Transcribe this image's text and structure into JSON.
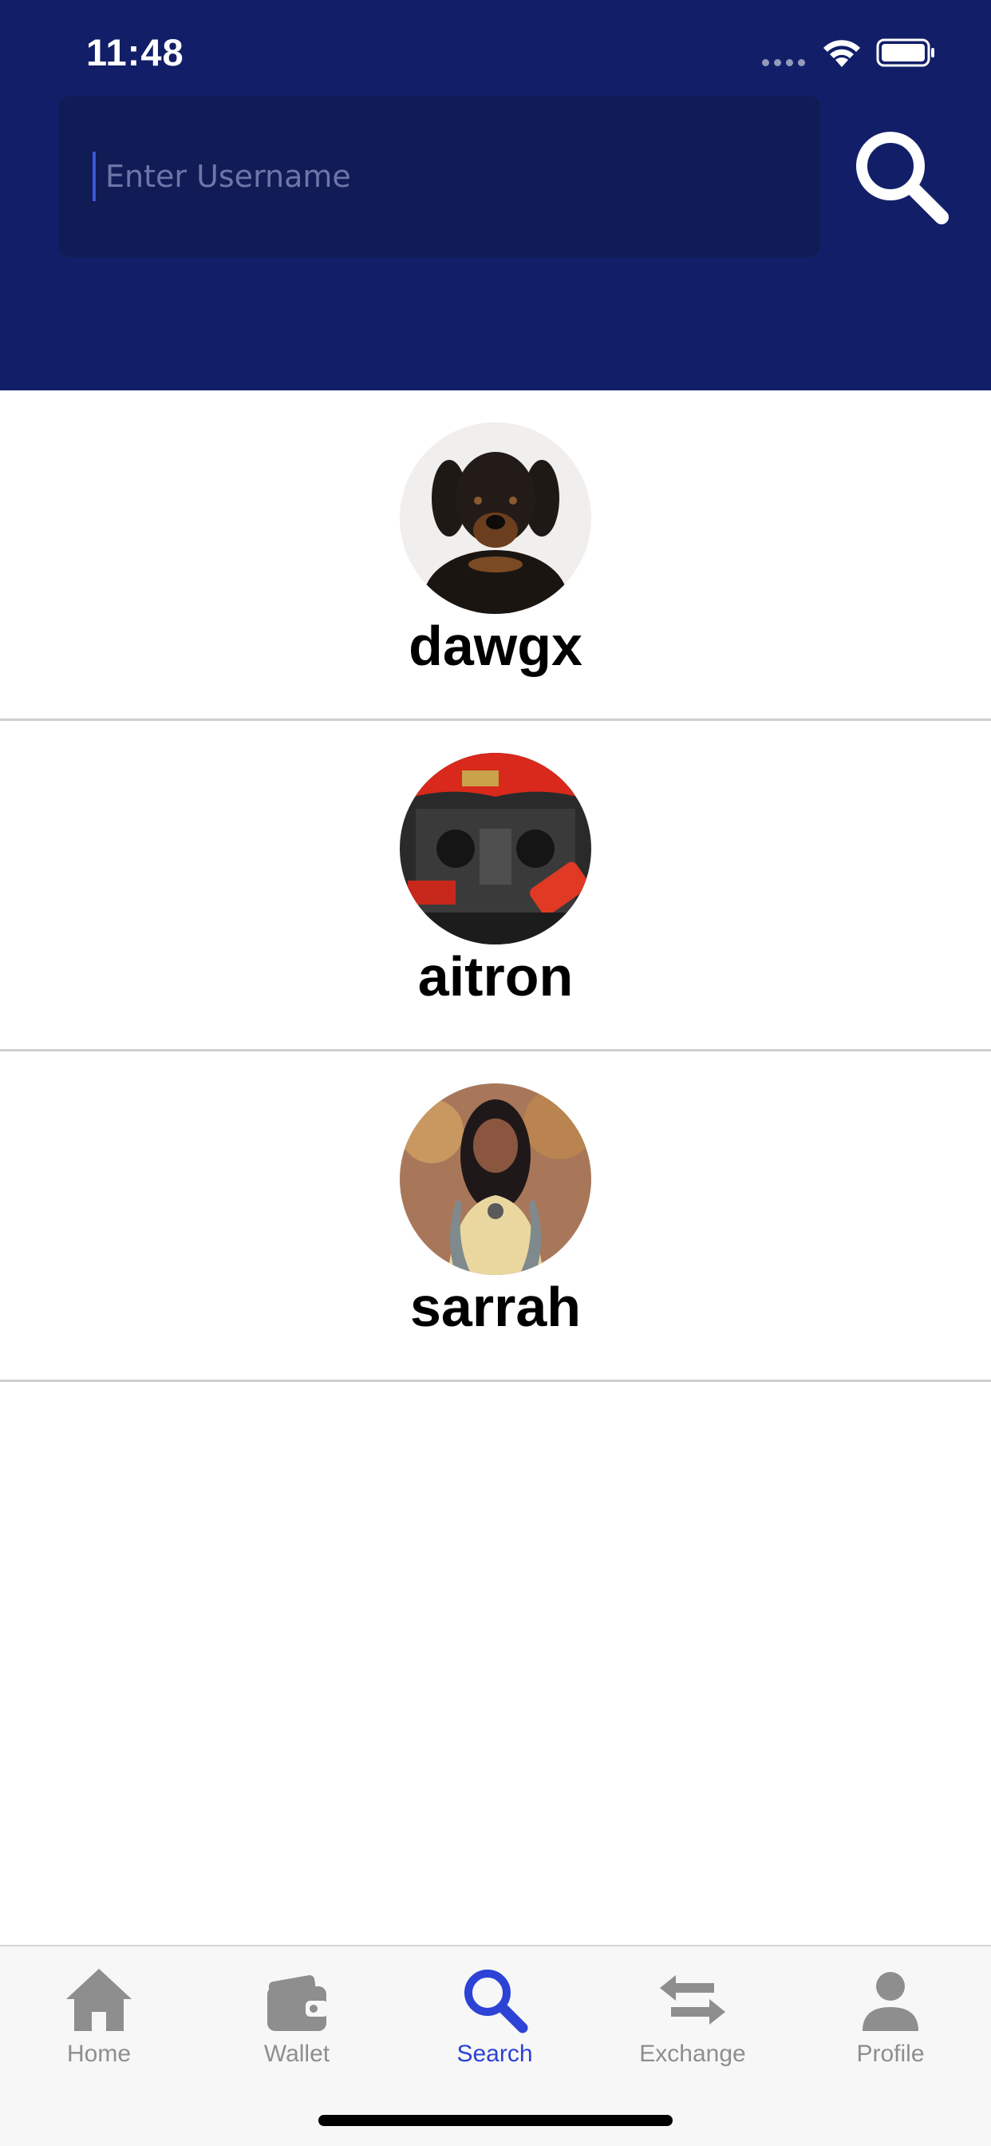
{
  "status_bar": {
    "time": "11:48"
  },
  "search": {
    "placeholder": "Enter Username",
    "value": ""
  },
  "results": [
    {
      "username": "dawgx",
      "avatar": "dog-photo"
    },
    {
      "username": "aitron",
      "avatar": "engine-photo"
    },
    {
      "username": "sarrah",
      "avatar": "woman-photo"
    }
  ],
  "tabs": [
    {
      "label": "Home",
      "icon": "home-icon"
    },
    {
      "label": "Wallet",
      "icon": "wallet-icon"
    },
    {
      "label": "Search",
      "icon": "search-icon"
    },
    {
      "label": "Exchange",
      "icon": "exchange-icon"
    },
    {
      "label": "Profile",
      "icon": "profile-icon"
    }
  ],
  "colors": {
    "header": "#121f68",
    "search_field": "#111b55",
    "accent": "#2c43d6",
    "inactive_tab": "#8e8e8e"
  }
}
